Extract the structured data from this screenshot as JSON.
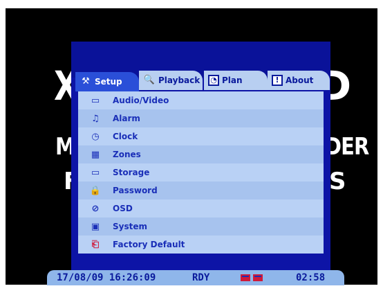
{
  "background_text": {
    "logo_left": "X",
    "logo_right": "D",
    "mid_left": "M",
    "mid_right": "DER",
    "low_left": "F",
    "low_right": "S"
  },
  "tabs": [
    {
      "label": "Setup",
      "icon": "tools-icon",
      "active": true
    },
    {
      "label": "Playback",
      "icon": "search-icon",
      "active": false
    },
    {
      "label": "Plan",
      "icon": "clock-icon",
      "active": false
    },
    {
      "label": "About",
      "icon": "info-icon",
      "active": false
    }
  ],
  "menu": {
    "items": [
      {
        "label": "Audio/Video",
        "icon": "audio-video-icon"
      },
      {
        "label": "Alarm",
        "icon": "bell-icon"
      },
      {
        "label": "Clock",
        "icon": "clock-icon"
      },
      {
        "label": "Zones",
        "icon": "zones-icon"
      },
      {
        "label": "Storage",
        "icon": "storage-icon"
      },
      {
        "label": "Password",
        "icon": "lock-icon"
      },
      {
        "label": "OSD",
        "icon": "osd-icon"
      },
      {
        "label": "System",
        "icon": "system-icon"
      },
      {
        "label": "Factory Default",
        "icon": "factory-default-icon"
      }
    ]
  },
  "status": {
    "datetime": "17/08/09 16:26:09",
    "state": "RDY",
    "time": "02:58"
  },
  "colors": {
    "panel_blue": "#0d14a6",
    "menu_light": "#b9d1f5",
    "menu_dark": "#a7c3ee",
    "status_blue": "#8fb6ea",
    "text_blue": "#1a2fb8"
  }
}
